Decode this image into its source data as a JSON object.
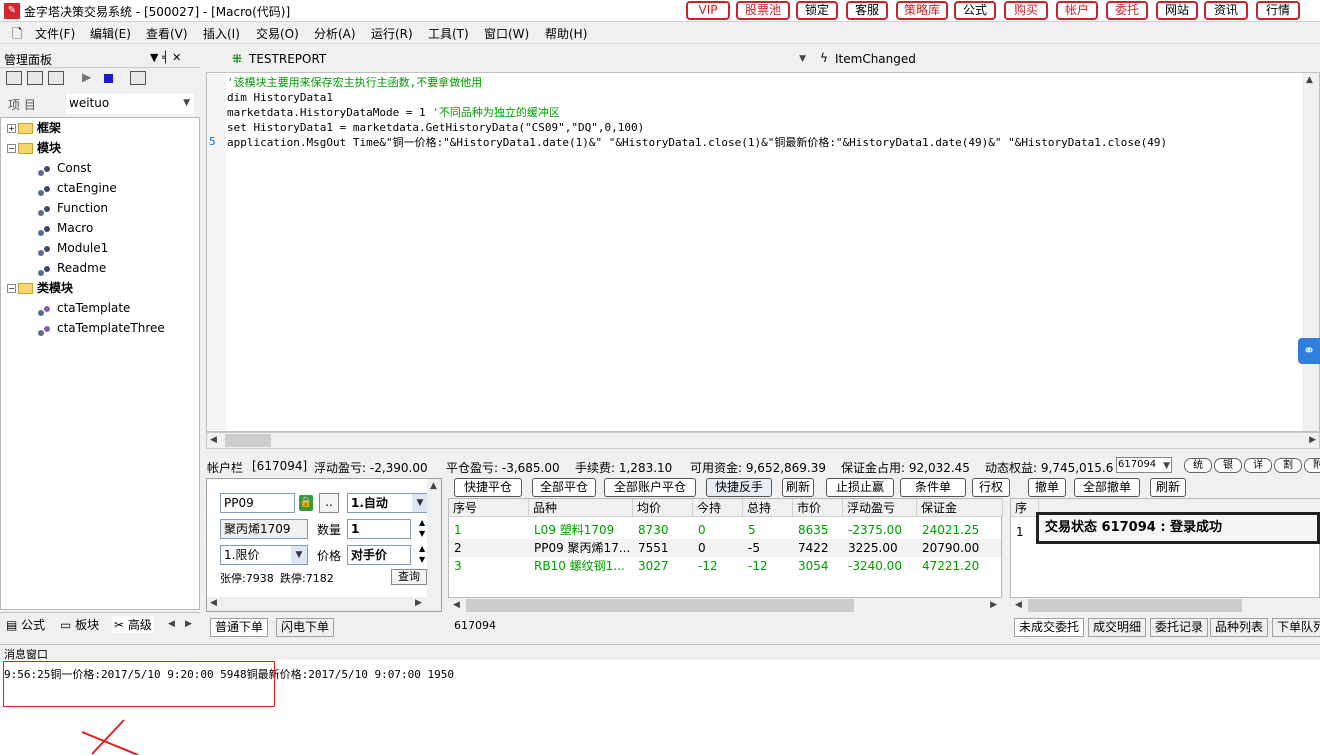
{
  "window": {
    "title": "金字塔决策交易系统 - [500027] - [Macro(代码)]",
    "app_icon": "pyramid-icon"
  },
  "top_buttons": [
    "VIP",
    "股票池",
    "锁定",
    "客服",
    "策略库",
    "公式",
    "购买",
    "帐户",
    "委托",
    "网站",
    "资讯",
    "行情"
  ],
  "menu": [
    "文件(F)",
    "编辑(E)",
    "查看(V)",
    "插入(I)",
    "交易(O)",
    "分析(A)",
    "运行(R)",
    "工具(T)",
    "窗口(W)",
    "帮助(H)"
  ],
  "panel": {
    "title": "管理面板",
    "pin_glyphs": "▼ ╡ ✕",
    "project_label": "项  目",
    "project_value": "weituo"
  },
  "tree": {
    "framework": "框架",
    "modules": "模块",
    "module_items": [
      "Const",
      "ctaEngine",
      "Function",
      "Macro",
      "Module1",
      "Readme"
    ],
    "class_modules": "类模块",
    "class_items": [
      "ctaTemplate",
      "ctaTemplateThree"
    ]
  },
  "left_tabs": [
    "公式",
    "板块",
    "高级"
  ],
  "editor": {
    "object_name": "TESTREPORT",
    "event_name": "ItemChanged",
    "line_marker": "5",
    "lines": [
      "'该模块主要用来保存宏主执行主函数,不要拿做他用",
      "dim HistoryData1",
      "marketdata.HistoryDataMode = 1 ",
      "'不同品种为独立的缓冲区",
      "set HistoryData1 = marketdata.GetHistoryData(\"CS09\",\"DQ\",0,100)",
      "application.MsgOut Time&\"铜一价格:\"&HistoryData1.date(1)&\"  \"&HistoryData1.close(1)&\"铜最新价格:\"&HistoryData1.date(49)&\"  \"&HistoryData1.close(49)"
    ]
  },
  "account_bar": {
    "label": "帐户栏",
    "account_id": "[617094]",
    "floating_pnl": "浮动盈亏: -2,390.00",
    "close_pnl": "平仓盈亏: -3,685.00",
    "fee": "手续费: 1,283.10",
    "available": "可用资金: 9,652,869.39",
    "margin": "保证金占用: 92,032.45",
    "equity": "动态权益: 9,745,015.6",
    "account_select": "617094",
    "extra_buttons": [
      "统",
      "银",
      "详",
      "割",
      "附"
    ]
  },
  "order_form": {
    "symbol": "PP09",
    "mode": "1.自动",
    "name": "聚丙烯1709",
    "qty_label": "数量",
    "qty": "1",
    "price_type": "1.限价",
    "price_label": "价格",
    "price": "对手价",
    "limit_up": "张停:7938",
    "limit_down": "跌停:7182",
    "query_btn": "查询"
  },
  "order_tabs": [
    "普通下单",
    "闪电下单"
  ],
  "action_buttons": [
    "快捷平仓",
    "全部平仓",
    "全部账户平仓",
    "快捷反手",
    "刷新",
    "止损止赢",
    "条件单",
    "行权",
    "撤单",
    "全部撤单",
    "刷新"
  ],
  "positions": {
    "headers": [
      "序号",
      "品种",
      "均价",
      "今持",
      "总持",
      "市价",
      "浮动盈亏",
      "保证金"
    ],
    "rows": [
      [
        "1",
        "L09 塑料1709",
        "8730",
        "0",
        "5",
        "8635",
        "-2375.00",
        "24021.25"
      ],
      [
        "2",
        "PP09 聚丙烯17...",
        "7551",
        "0",
        "-5",
        "7422",
        "3225.00",
        "20790.00"
      ],
      [
        "3",
        "RB10 螺纹钢1...",
        "3027",
        "-12",
        "-12",
        "3054",
        "-3240.00",
        "47221.20"
      ]
    ],
    "row_colors": [
      "#009a00",
      "#000000",
      "#009a00"
    ]
  },
  "status_account": "617094",
  "orders": {
    "header_first": "序",
    "row_first": "1",
    "toast": "交易状态 617094 : 登录成功"
  },
  "orders_tabs": [
    "未成交委托",
    "成交明细",
    "委托记录",
    "品种列表",
    "下单队列"
  ],
  "message": {
    "header": "消息窗口",
    "line": "9:56:25铜一价格:2017/5/10 9:20:00  5948铜最新价格:2017/5/10 9:07:00  1950"
  }
}
